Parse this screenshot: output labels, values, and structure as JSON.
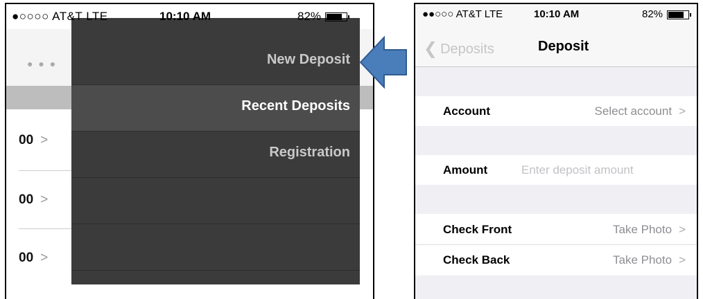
{
  "left_phone": {
    "status": {
      "carrier": "●○○○○ AT&T  LTE",
      "time": "10:10 AM",
      "battery": "82%"
    },
    "background_values": [
      "00",
      "00",
      "00"
    ],
    "menu": {
      "items": [
        {
          "label": "New Deposit",
          "color": "#c9c9c9"
        },
        {
          "label": "Recent Deposits",
          "color": "#ffffff"
        },
        {
          "label": "Registration",
          "color": "#c9c9c9"
        },
        {
          "label": "",
          "color": "#c9c9c9"
        },
        {
          "label": "",
          "color": "#c9c9c9"
        }
      ]
    }
  },
  "arrow": {
    "color": "#4a7ebb",
    "direction": "left"
  },
  "right_phone": {
    "status": {
      "carrier": "●●○○○ AT&T  LTE",
      "time": "10:10 AM",
      "battery": "82%"
    },
    "nav": {
      "back_label": "Deposits",
      "title": "Deposit"
    },
    "form": {
      "account": {
        "label": "Account",
        "value": "Select account"
      },
      "amount": {
        "label": "Amount",
        "placeholder": "Enter deposit amount"
      },
      "check_front": {
        "label": "Check Front",
        "value": "Take Photo"
      },
      "check_back": {
        "label": "Check Back",
        "value": "Take Photo"
      }
    }
  }
}
